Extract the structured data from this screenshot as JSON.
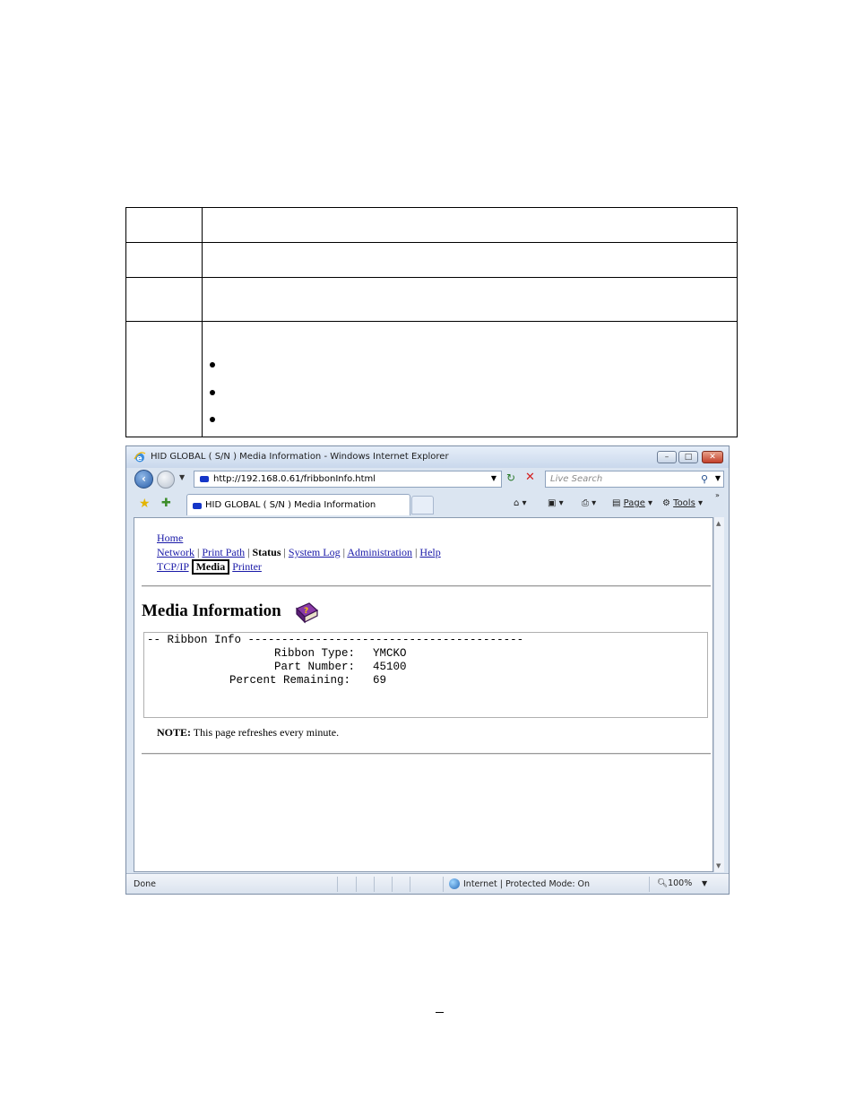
{
  "browser": {
    "window_title": "HID GLOBAL ( S/N ) Media Information - Windows Internet Explorer",
    "buttons": {
      "minimize": "–",
      "maximize": "□",
      "close": "✕"
    },
    "address_url": "http://192.168.0.61/fribbonInfo.html",
    "search_placeholder": "Live Search",
    "tab_title": "HID GLOBAL ( S/N ) Media Information",
    "toolbar": {
      "page_label": "Page",
      "tools_label": "Tools"
    },
    "status": {
      "done": "Done",
      "zone": "Internet | Protected Mode: On",
      "zoom": "100%"
    },
    "icons": [
      "ie-logo-icon",
      "back-icon",
      "forward-icon",
      "refresh-icon",
      "stop-icon",
      "search-icon",
      "favorites-star-icon",
      "add-favorite-icon",
      "home-icon",
      "feeds-icon",
      "print-icon",
      "page-icon",
      "tools-gear-icon",
      "globe-icon",
      "zoom-icon"
    ]
  },
  "page": {
    "nav": {
      "home": "Home",
      "row2": {
        "network": "Network",
        "print_path": "Print Path",
        "status": "Status",
        "system_log": "System Log",
        "administration": "Administration",
        "help": "Help",
        "sep": "|"
      },
      "row3": {
        "tcpip": "TCP/IP",
        "media": "Media",
        "printer": "Printer"
      }
    },
    "title": "Media Information",
    "ribbon_info": {
      "header": "-- Ribbon Info -----------------------------------------",
      "ribbon_type_label": "Ribbon Type:",
      "ribbon_type": "YMCKO",
      "part_number_label": "Part Number:",
      "part_number": "45100",
      "percent_label": "Percent Remaining:",
      "percent": "69"
    },
    "note_label": "NOTE:",
    "note_text": " This page refreshes every minute."
  },
  "colors": {
    "link": "#1a1aa8",
    "window_frame": "#dbe5f1",
    "close_button": "#c3402b"
  }
}
